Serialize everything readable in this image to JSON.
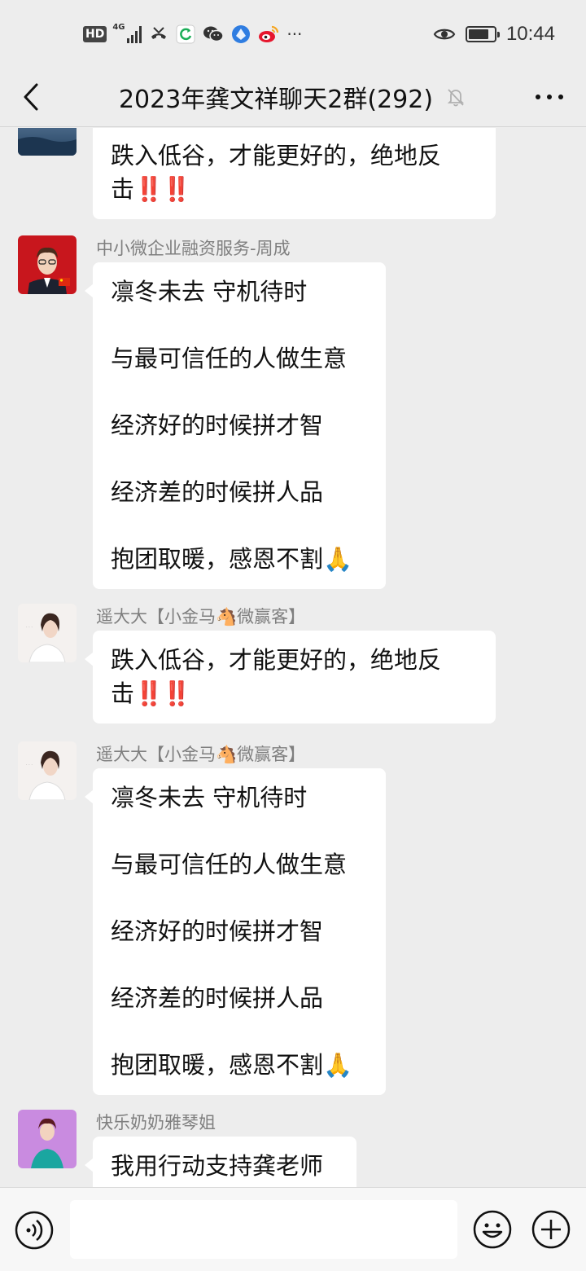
{
  "status_bar": {
    "hd": "HD",
    "net": "4G",
    "time": "10:44",
    "battery_level": 0.8,
    "icons": [
      "hd-icon",
      "signal-icon",
      "missed-call-icon",
      "sync-app-icon",
      "wechat-icon",
      "browser-icon",
      "weibo-icon",
      "more-notifications-icon",
      "eye-icon",
      "battery-icon"
    ]
  },
  "header": {
    "title": "2023年龚文祥聊天2群(292)",
    "icons": [
      "back-icon",
      "mute-bell-icon",
      "more-icon"
    ]
  },
  "messages": [
    {
      "sender": "",
      "lines": [
        "跌入低谷，才能更好的，绝地反",
        "击"
      ],
      "emoji": "‼️‼️"
    },
    {
      "sender": "中小微企业融资服务-周成",
      "lines": [
        "凛冬未去 守机待时",
        "与最可信任的人做生意",
        "经济好的时候拼才智",
        "经济差的时候拼人品",
        "抱团取暖，感恩不割"
      ],
      "emoji": "🙏"
    },
    {
      "sender": "遥大大【小金马🐴微赢客】",
      "lines": [
        "跌入低谷，才能更好的，绝地反",
        "击"
      ],
      "emoji": "‼️‼️"
    },
    {
      "sender": "遥大大【小金马🐴微赢客】",
      "lines": [
        "凛冬未去 守机待时",
        "与最可信任的人做生意",
        "经济好的时候拼才智",
        "经济差的时候拼人品",
        "抱团取暖，感恩不割"
      ],
      "emoji": "🙏"
    },
    {
      "sender": "快乐奶奶雅琴姐",
      "lines": [
        "我用行动支持龚老师"
      ],
      "emoji": ""
    }
  ],
  "footer": {
    "input_value": "",
    "icons": [
      "voice-icon",
      "emoji-icon",
      "plus-icon"
    ]
  },
  "colors": {
    "background": "#ededed",
    "bubble": "#ffffff",
    "nickname": "#7f7f7f",
    "accent_red": "#e0211b"
  }
}
